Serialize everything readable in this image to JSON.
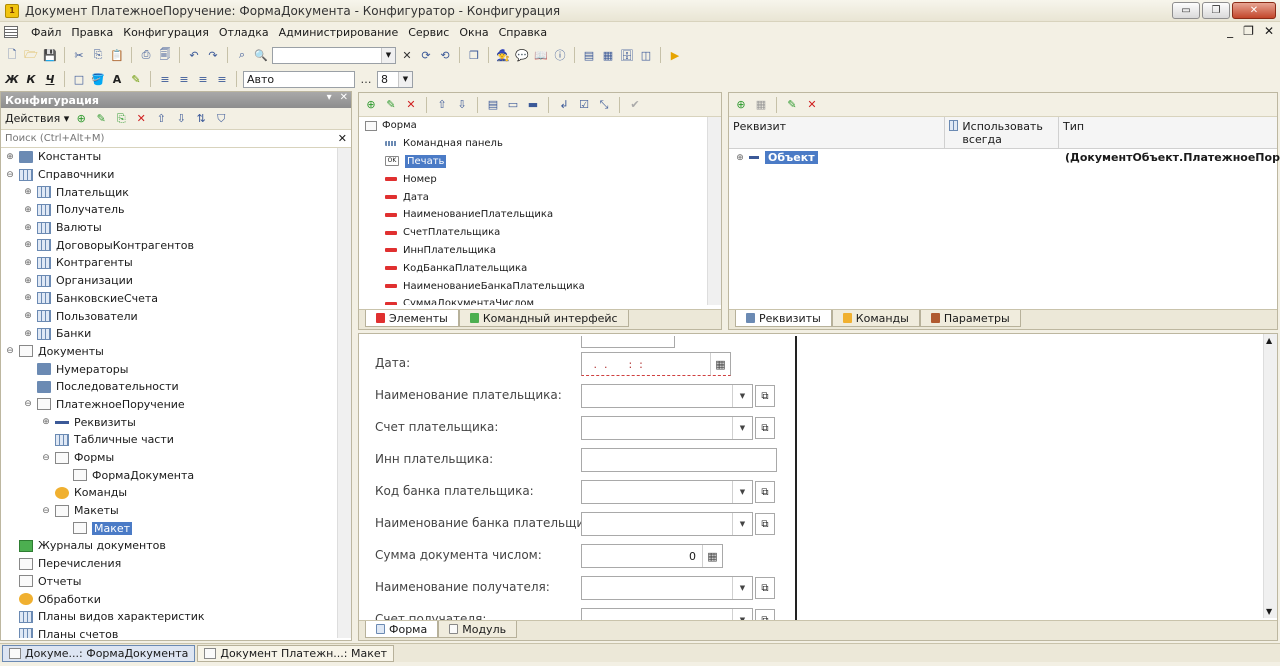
{
  "window": {
    "title": "Документ ПлатежноеПоручение: ФормаДокумента - Конфигуратор - Конфигурация",
    "buttons": [
      "▭",
      "❐",
      "✕"
    ]
  },
  "menu": {
    "items": [
      "Файл",
      "Правка",
      "Конфигурация",
      "Отладка",
      "Администрирование",
      "Сервис",
      "Окна",
      "Справка"
    ],
    "mdi": [
      "_",
      "❐",
      "✕"
    ]
  },
  "toolbar": {
    "font_name": "Авто",
    "font_size": "8",
    "bold": "Ж",
    "italic": "К",
    "underline": "Ч",
    "text_color": "A"
  },
  "config_panel": {
    "title": "Конфигурация",
    "pin": "▾",
    "close": "✕",
    "actions_label": "Действия ▾",
    "search_placeholder": "Поиск (Ctrl+Alt+M)",
    "tree": [
      {
        "label": "Константы",
        "level": 0,
        "toggle": "⊕",
        "icon": "const"
      },
      {
        "label": "Справочники",
        "level": 0,
        "toggle": "⊖",
        "icon": "table"
      },
      {
        "label": "Плательщик",
        "level": 1,
        "toggle": "⊕",
        "icon": "table"
      },
      {
        "label": "Получатель",
        "level": 1,
        "toggle": "⊕",
        "icon": "table"
      },
      {
        "label": "Валюты",
        "level": 1,
        "toggle": "⊕",
        "icon": "table"
      },
      {
        "label": "ДоговорыКонтрагентов",
        "level": 1,
        "toggle": "⊕",
        "icon": "table"
      },
      {
        "label": "Контрагенты",
        "level": 1,
        "toggle": "⊕",
        "icon": "table"
      },
      {
        "label": "Организации",
        "level": 1,
        "toggle": "⊕",
        "icon": "table"
      },
      {
        "label": "БанковскиеСчета",
        "level": 1,
        "toggle": "⊕",
        "icon": "table"
      },
      {
        "label": "Пользователи",
        "level": 1,
        "toggle": "⊕",
        "icon": "table"
      },
      {
        "label": "Банки",
        "level": 1,
        "toggle": "⊕",
        "icon": "table"
      },
      {
        "label": "Документы",
        "level": 0,
        "toggle": "⊖",
        "icon": "doc"
      },
      {
        "label": "Нумераторы",
        "level": 1,
        "toggle": "",
        "icon": "const"
      },
      {
        "label": "Последовательности",
        "level": 1,
        "toggle": "",
        "icon": "const"
      },
      {
        "label": "ПлатежноеПоручение",
        "level": 1,
        "toggle": "⊖",
        "icon": "doc"
      },
      {
        "label": "Реквизиты",
        "level": 2,
        "toggle": "⊕",
        "icon": "dash"
      },
      {
        "label": "Табличные части",
        "level": 2,
        "toggle": "",
        "icon": "table"
      },
      {
        "label": "Формы",
        "level": 2,
        "toggle": "⊖",
        "icon": "doc"
      },
      {
        "label": "ФормаДокумента",
        "level": 3,
        "toggle": "",
        "icon": "doc"
      },
      {
        "label": "Команды",
        "level": 2,
        "toggle": "",
        "icon": "orange"
      },
      {
        "label": "Макеты",
        "level": 2,
        "toggle": "⊖",
        "icon": "doc"
      },
      {
        "label": "Макет",
        "level": 3,
        "toggle": "",
        "icon": "doc",
        "selected": true
      },
      {
        "label": "Журналы документов",
        "level": 0,
        "toggle": "",
        "icon": "green"
      },
      {
        "label": "Перечисления",
        "level": 0,
        "toggle": "",
        "icon": "doc"
      },
      {
        "label": "Отчеты",
        "level": 0,
        "toggle": "",
        "icon": "doc"
      },
      {
        "label": "Обработки",
        "level": 0,
        "toggle": "",
        "icon": "orange"
      },
      {
        "label": "Планы видов характеристик",
        "level": 0,
        "toggle": "",
        "icon": "table"
      },
      {
        "label": "Планы счетов",
        "level": 0,
        "toggle": "",
        "icon": "table"
      }
    ]
  },
  "elements_panel": {
    "root": "Форма",
    "items": [
      {
        "label": "Командная панель",
        "icon": "panel"
      },
      {
        "label": "Печать",
        "icon": "btn",
        "selected": true
      },
      {
        "label": "Номер",
        "icon": "field"
      },
      {
        "label": "Дата",
        "icon": "field"
      },
      {
        "label": "НаименованиеПлательщика",
        "icon": "field"
      },
      {
        "label": "СчетПлательщика",
        "icon": "field"
      },
      {
        "label": "ИннПлательщика",
        "icon": "field"
      },
      {
        "label": "КодБанкаПлательщика",
        "icon": "field"
      },
      {
        "label": "НаименованиеБанкаПлательщика",
        "icon": "field"
      },
      {
        "label": "СуммаДокументаЧислом",
        "icon": "field"
      }
    ],
    "button_text": "OK",
    "tabs": [
      "Элементы",
      "Командный интерфейс"
    ]
  },
  "attributes_panel": {
    "columns": [
      "Реквизит",
      "Использовать всегда",
      "Тип"
    ],
    "rows": [
      {
        "name": "Объект",
        "type": "(ДокументОбъект.ПлатежноеПору…"
      }
    ],
    "tabs": [
      "Реквизиты",
      "Команды",
      "Параметры"
    ]
  },
  "form_preview": {
    "fields": [
      {
        "label": "Дата:",
        "value": " .  .      :  :",
        "kind": "date"
      },
      {
        "label": "Наименование плательщика:",
        "value": "",
        "kind": "select"
      },
      {
        "label": "Счет плательщика:",
        "value": "",
        "kind": "select"
      },
      {
        "label": "Инн плательщика:",
        "value": "",
        "kind": "text"
      },
      {
        "label": "Код банка плательщика:",
        "value": "",
        "kind": "select"
      },
      {
        "label": "Наименование банка плательщика:",
        "value": "",
        "kind": "select"
      },
      {
        "label": "Сумма документа числом:",
        "value": "0",
        "kind": "number"
      },
      {
        "label": "Наименование получателя:",
        "value": "",
        "kind": "select"
      },
      {
        "label": "Счет получателя:",
        "value": "",
        "kind": "select"
      }
    ],
    "tabs": [
      "Форма",
      "Модуль"
    ]
  },
  "window_tabs": [
    {
      "label": "Докуме...: ФормаДокумента",
      "active": true
    },
    {
      "label": "Документ Платежн...: Макет",
      "active": false
    }
  ],
  "colors": {
    "selection": "#4b7bc6",
    "panel_bg": "#f3f0e4",
    "accent_red": "#e03030"
  }
}
